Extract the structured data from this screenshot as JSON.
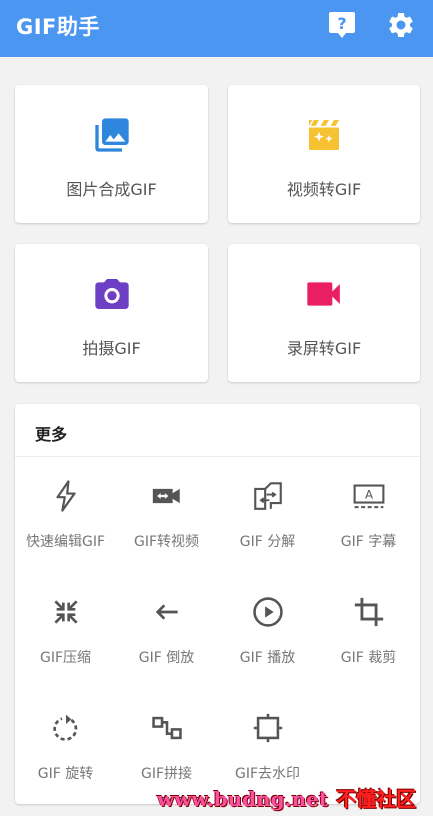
{
  "appbar": {
    "title": "GIF助手",
    "help_icon": "help-icon",
    "settings_icon": "gear-icon",
    "color": "#4a96f1"
  },
  "cards": [
    {
      "label": "图片合成GIF",
      "icon": "photo-library-icon",
      "color": "#2f86dd"
    },
    {
      "label": "视频转GIF",
      "icon": "movie-clapper-icon",
      "color": "#f6c232"
    },
    {
      "label": "拍摄GIF",
      "icon": "camera-icon",
      "color": "#6c3fc4"
    },
    {
      "label": "录屏转GIF",
      "icon": "video-camera-icon",
      "color": "#ea1f63"
    }
  ],
  "more": {
    "heading": "更多",
    "tools": [
      {
        "label": "快速编辑GIF",
        "icon": "lightning-icon"
      },
      {
        "label": "GIF转视频",
        "icon": "video-convert-icon"
      },
      {
        "label": "GIF 分解",
        "icon": "split-frames-icon"
      },
      {
        "label": "GIF 字幕",
        "icon": "subtitle-icon"
      },
      {
        "label": "GIF压缩",
        "icon": "compress-icon"
      },
      {
        "label": "GIF 倒放",
        "icon": "arrow-left-icon"
      },
      {
        "label": "GIF 播放",
        "icon": "play-circle-icon"
      },
      {
        "label": "GIF 裁剪",
        "icon": "crop-icon"
      },
      {
        "label": "GIF 旋转",
        "icon": "rotate-icon"
      },
      {
        "label": "GIF拼接",
        "icon": "join-icon"
      },
      {
        "label": "GIF去水印",
        "icon": "watermark-remove-icon"
      }
    ]
  },
  "watermark": {
    "site": "www.budng.net",
    "name": "不懂社区"
  }
}
